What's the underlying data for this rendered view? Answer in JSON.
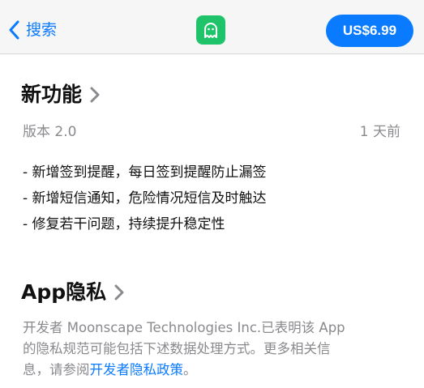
{
  "navbar": {
    "back_label": "搜索",
    "app_icon": "ghost-icon",
    "price": "US$6.99",
    "colors": {
      "accent": "#0a7aff",
      "app_icon_bg": "#1fc46a"
    }
  },
  "whats_new": {
    "title": "新功能",
    "version": "版本 2.0",
    "date": "1 天前",
    "notes": [
      "- 新增签到提醒，每日签到提醒防止漏签",
      "- 新增短信通知，危险情况短信及时触达",
      "- 修复若干问题，持续提升稳定性"
    ]
  },
  "privacy": {
    "title": "App隐私",
    "line1": "开发者 Moonscape Technologies Inc.已表明该 App",
    "line2": "的隐私规范可能包括下述数据处理方式。更多相关信",
    "line3_prefix": "息，请参阅",
    "link": "开发者隐私政策",
    "line3_suffix": "。"
  }
}
